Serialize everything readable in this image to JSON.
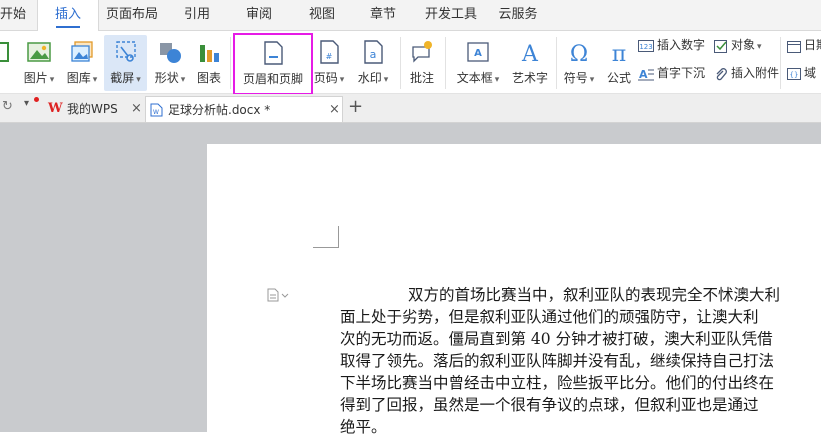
{
  "menu": {
    "tabs": [
      "开始",
      "插入",
      "页面布局",
      "引用",
      "审阅",
      "视图",
      "章节",
      "开发工具",
      "云服务"
    ],
    "active": "插入"
  },
  "ribbon": {
    "picture": "图片",
    "gallery": "图库",
    "screenshot": "截屏",
    "shapes": "形状",
    "chart": "图表",
    "header_footer": "页眉和页脚",
    "page_number": "页码",
    "watermark": "水印",
    "comment": "批注",
    "textbox": "文本框",
    "wordart": "艺术字",
    "symbol": "符号",
    "formula": "公式",
    "insert_number": "插入数字",
    "object": "对象",
    "drop_cap": "首字下沉",
    "insert_attachment": "插入附件",
    "date": "日期",
    "domain": "域"
  },
  "tabs": {
    "wps_home": "我的WPS",
    "document": "足球分析帖.docx *",
    "add": "+"
  },
  "document": {
    "lines": [
      "双方的首场比赛当中，叙利亚队的表现完全不怵澳大利",
      "面上处于劣势，但是叙利亚队通过他们的顽强防守，让澳大利",
      "次的无功而返。僵局直到第 40 分钟才被打破，澳大利亚队凭借",
      "取得了领先。落后的叙利亚队阵脚并没有乱，继续保持自己打法",
      "下半场比赛当中曾经击中立柱，险些扳平比分。他们的付出终在",
      "得到了回报，虽然是一个很有争议的点球，但叙利亚也是通过",
      "绝平。"
    ]
  },
  "colors": {
    "accent": "#2f6fd0",
    "highlight_box": "#e61be6",
    "workspace": "#c9cbce"
  }
}
